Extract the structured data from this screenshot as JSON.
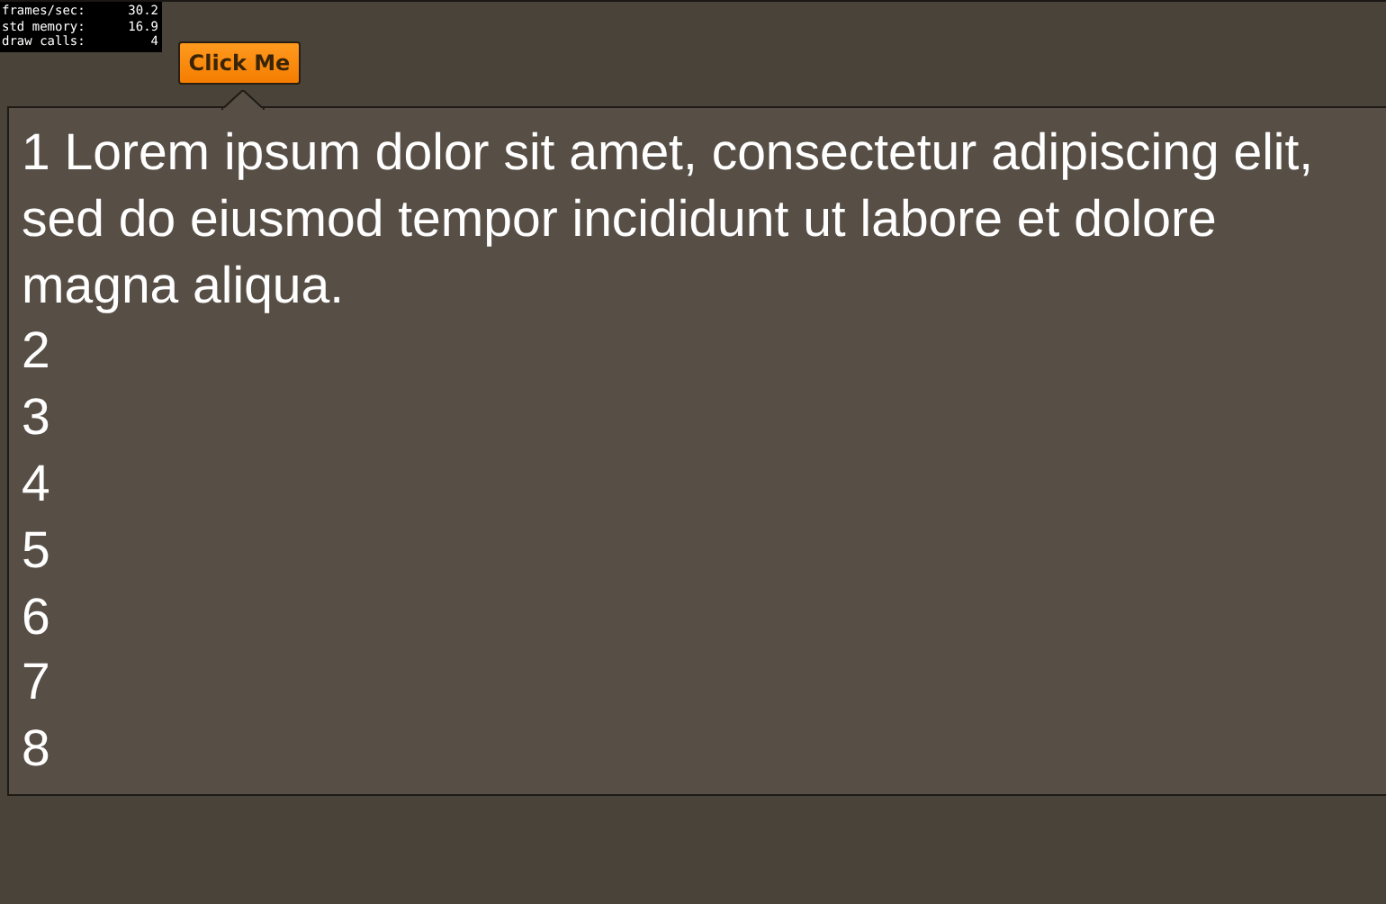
{
  "stats": [
    {
      "label": "frames/sec:",
      "value": "30.2"
    },
    {
      "label": "std memory:",
      "value": "16.9"
    },
    {
      "label": "draw calls:",
      "value": "4"
    }
  ],
  "button": {
    "label": "Click Me"
  },
  "popover": {
    "lines": [
      "1 Lorem ipsum dolor sit amet, consectetur adipiscing elit, sed do eiusmod tempor incididunt ut labore et dolore magna aliqua.",
      "2",
      "3",
      "4",
      "5",
      "6",
      "7",
      "8"
    ]
  }
}
